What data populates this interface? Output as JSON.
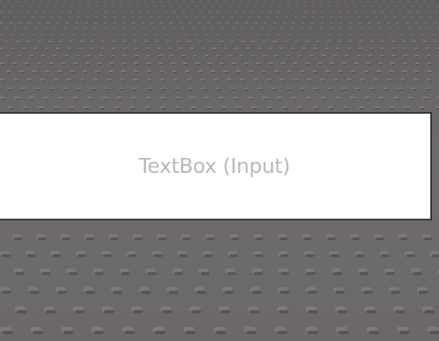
{
  "textbox": {
    "placeholder": "TextBox (Input)",
    "value": ""
  },
  "colors": {
    "baseplate": "#6d6a6c",
    "textbox_background": "#ffffff",
    "textbox_border": "#2e3136",
    "placeholder_text": "#b8b8b8"
  }
}
